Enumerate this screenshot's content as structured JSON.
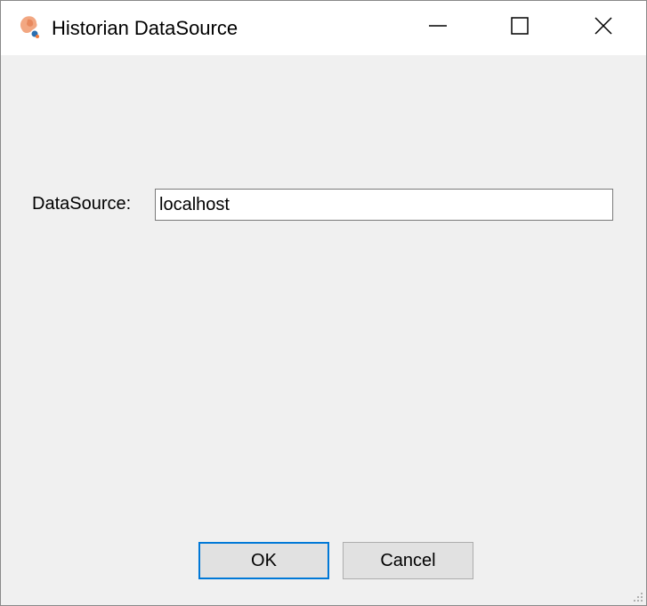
{
  "window": {
    "title": "Historian DataSource",
    "app_icon": "historian-app-icon",
    "controls": {
      "minimize_icon": "minimize-icon",
      "maximize_icon": "maximize-icon",
      "close_icon": "close-icon"
    }
  },
  "form": {
    "datasource_label": "DataSource:",
    "datasource_value": "localhost"
  },
  "buttons": {
    "ok_label": "OK",
    "cancel_label": "Cancel"
  },
  "colors": {
    "focus_border": "#0078d7",
    "dialog_background": "#f0f0f0",
    "button_face": "#e1e1e1"
  }
}
